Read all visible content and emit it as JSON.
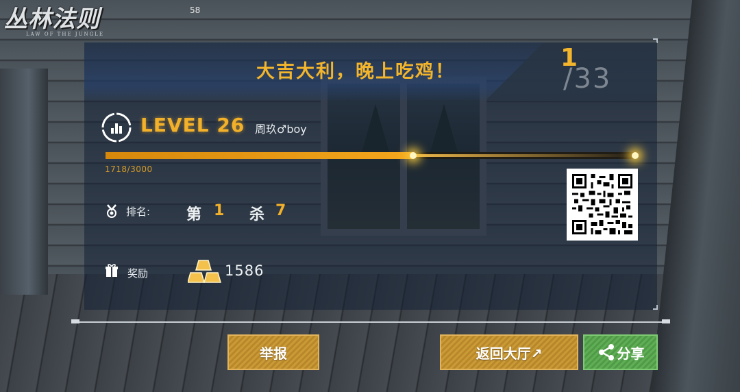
{
  "logo": {
    "title": "丛林法则",
    "subtitle": "LAW OF THE JUNGLE"
  },
  "fps": "58",
  "result": {
    "title": "大吉大利，晚上吃鸡！",
    "rank": "1",
    "total": "/33"
  },
  "player": {
    "level_label": "LEVEL 26",
    "name": "周玖♂boy",
    "xp_text": "1718/3000",
    "xp_current": 1718,
    "xp_max": 3000
  },
  "stats": {
    "rank_label": "排名:",
    "rank_prefix": "第",
    "rank_value": "1",
    "kill_prefix": "杀",
    "kill_value": "7"
  },
  "reward": {
    "label": "奖励",
    "value": "1586"
  },
  "buttons": {
    "report": "举报",
    "back_lobby": "返回大厅↗",
    "share": "分享"
  },
  "icons": {
    "level": "level-badge-icon",
    "medal": "medal-icon",
    "gift": "gift-icon",
    "gold": "gold-bars-icon",
    "share": "share-icon",
    "qr": "qr-code"
  },
  "colors": {
    "accent": "#f3b12a",
    "button_gold": "#c99a36",
    "button_green": "#5fae55"
  }
}
